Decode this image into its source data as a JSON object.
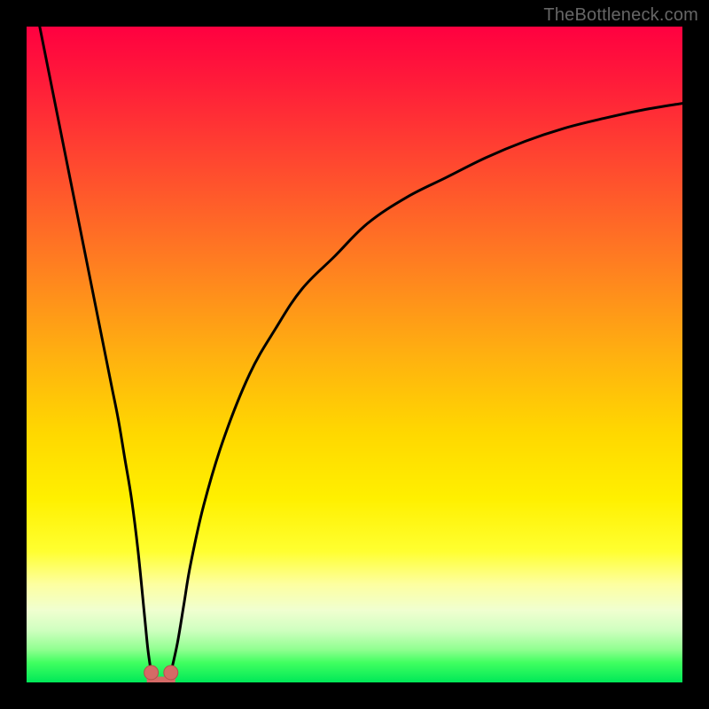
{
  "attribution": "TheBottleneck.com",
  "colors": {
    "page_bg": "#000000",
    "text": "#666666",
    "curve": "#000000",
    "marker_fill": "#d56a66",
    "marker_stroke": "#b84e4a",
    "gradient_top": "#ff0040",
    "gradient_bottom": "#00e858"
  },
  "chart_data": {
    "type": "line",
    "title": "",
    "xlabel": "",
    "ylabel": "",
    "xlim": [
      0,
      100
    ],
    "ylim": [
      0,
      100
    ],
    "grid": false,
    "legend": false,
    "annotations": [],
    "series": [
      {
        "name": "left-branch",
        "x": [
          2,
          4,
          6,
          8,
          9,
          10,
          11,
          12,
          13,
          14,
          15,
          16,
          17,
          18,
          18.5,
          19
        ],
        "values": [
          100,
          90,
          80,
          70,
          65,
          60,
          55,
          50,
          45,
          40,
          34,
          28,
          20,
          10,
          5,
          1.5
        ]
      },
      {
        "name": "right-branch",
        "x": [
          22,
          23,
          24,
          25,
          27,
          30,
          34,
          38,
          42,
          47,
          52,
          58,
          64,
          70,
          76,
          82,
          88,
          94,
          100
        ],
        "values": [
          1.5,
          6,
          12,
          18,
          27,
          37,
          47,
          54,
          60,
          65,
          70,
          74,
          77,
          80,
          82.5,
          84.5,
          86,
          87.3,
          88.3
        ]
      }
    ],
    "markers": [
      {
        "x": 19,
        "y": 1.5
      },
      {
        "x": 22,
        "y": 1.5
      }
    ],
    "notch": {
      "left_x": 19,
      "right_x": 22,
      "bottom_y": 0.2,
      "top_y": 1.5
    }
  }
}
